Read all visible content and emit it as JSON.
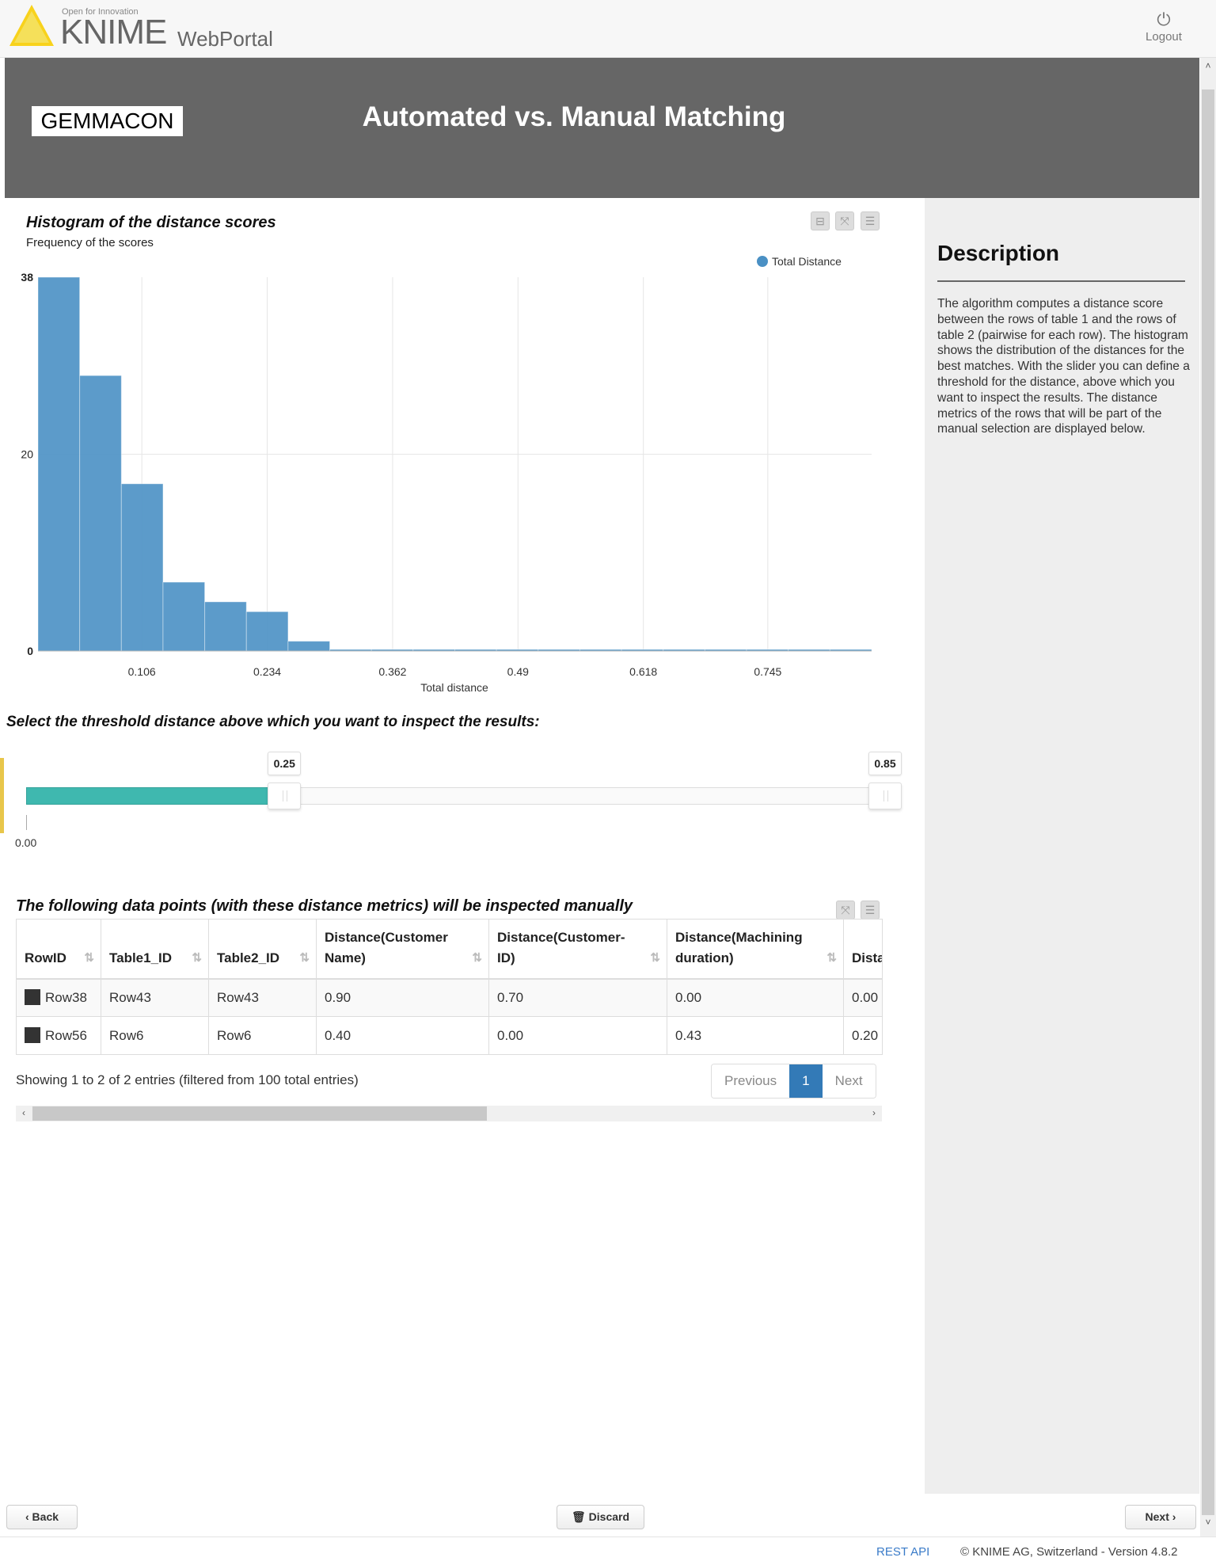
{
  "topbar": {
    "logo_tagline": "Open for Innovation",
    "logo_name": "KNIME",
    "logo_product": "WebPortal",
    "logout_label": "Logout",
    "logout_icon": "power-icon"
  },
  "banner": {
    "brand": "GEMMACON",
    "title": "Automated vs. Manual Matching"
  },
  "histogram": {
    "title": "Histogram of the distance scores",
    "subtitle": "Frequency of the scores"
  },
  "chart_data": {
    "type": "bar",
    "title": "Histogram of the distance scores",
    "subtitle": "Frequency of the scores",
    "xlabel": "Total distance",
    "ylabel": "",
    "xlim": [
      0.0,
      0.851
    ],
    "ylim": [
      0,
      38
    ],
    "x_ticks": [
      "0.106",
      "0.234",
      "0.362",
      "0.49",
      "0.618",
      "0.745"
    ],
    "x_tick_values": [
      0.106,
      0.234,
      0.362,
      0.49,
      0.618,
      0.745
    ],
    "y_ticks": [
      "0",
      "20",
      "38"
    ],
    "y_tick_values": [
      0,
      20,
      38
    ],
    "bin_count": 20,
    "series": [
      {
        "name": "Total Distance",
        "color": "#4a90c4",
        "values": [
          38,
          28,
          17,
          7,
          5,
          4,
          1,
          0,
          0,
          0,
          0,
          0,
          0,
          0,
          0,
          0,
          0,
          0,
          0,
          0
        ]
      }
    ],
    "legend": "top-right",
    "grid": true
  },
  "slider": {
    "question": "Select the threshold distance above which you want to inspect the results:",
    "low": 0.25,
    "high": 0.85,
    "low_label": "0.25",
    "high_label": "0.85",
    "min_label": "0.00",
    "range_max": 0.85,
    "fill_color": "#3fb8af"
  },
  "table": {
    "title": "The following data points (with these distance metrics) will be inspected manually",
    "columns": [
      "RowID",
      "Table1_ID",
      "Table2_ID",
      "Distance(Customer Name)",
      "Distance(Customer-ID)",
      "Distance(Machining duration)",
      "Distance(Date"
    ],
    "rows": [
      [
        "Row38",
        "Row43",
        "Row43",
        "0.90",
        "0.70",
        "0.00",
        "0.00"
      ],
      [
        "Row56",
        "Row6",
        "Row6",
        "0.40",
        "0.00",
        "0.43",
        "0.20"
      ]
    ],
    "info": "Showing 1 to 2 of 2 entries (filtered from 100 total entries)",
    "pager": {
      "previous": "Previous",
      "current": "1",
      "next": "Next"
    }
  },
  "description": {
    "heading": "Description",
    "text": "The algorithm computes a distance score between the rows of table 1 and the rows of table 2 (pairwise for each row). The histogram shows the distribution of the distances for the best matches. With the slider you can define a threshold for the distance, above which you want to inspect the results. The distance metrics of the rows that will be part of the manual selection are displayed below."
  },
  "nav": {
    "back": "Back",
    "discard": "Discard",
    "next": "Next"
  },
  "footer": {
    "rest_api": "REST API",
    "copyright": "© KNIME AG, Switzerland - Version 4.8.2"
  }
}
